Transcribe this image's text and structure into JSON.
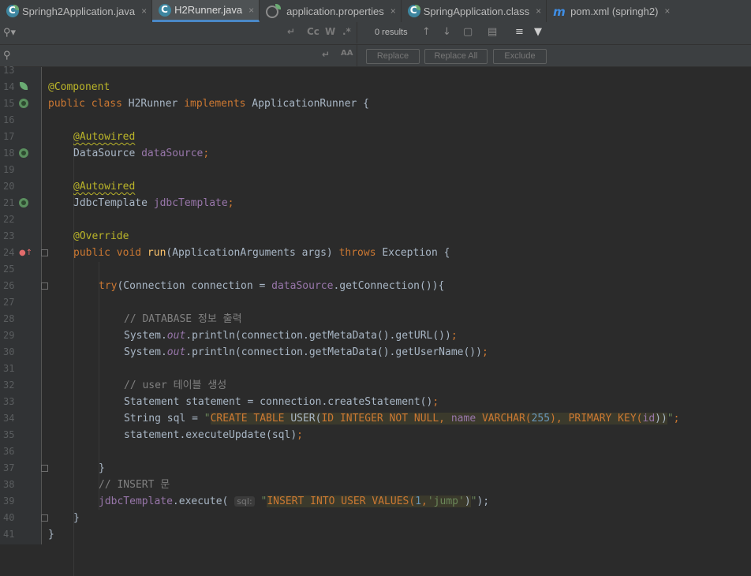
{
  "tabs": [
    {
      "label": "Springh2Application.java",
      "icon": "java-class-spring-icon",
      "active": false
    },
    {
      "label": "H2Runner.java",
      "icon": "java-class-icon",
      "active": true
    },
    {
      "label": "application.properties",
      "icon": "spring-properties-icon",
      "active": false
    },
    {
      "label": "SpringApplication.class",
      "icon": "java-class-spring-icon",
      "active": false
    },
    {
      "label": "pom.xml (springh2)",
      "icon": "maven-icon",
      "active": false
    }
  ],
  "close_glyph": "×",
  "find": {
    "search_placeholder": "",
    "replace_placeholder": "",
    "results": "0 results",
    "match_case": "Cc",
    "words": "W",
    "regex": ".*",
    "preserve_case": "AA",
    "replace_label": "Replace",
    "replace_all_label": "Replace All",
    "exclude_label": "Exclude"
  },
  "lines": [
    {
      "n": "13"
    },
    {
      "n": "14"
    },
    {
      "n": "15"
    },
    {
      "n": "16"
    },
    {
      "n": "17"
    },
    {
      "n": "18"
    },
    {
      "n": "19"
    },
    {
      "n": "20"
    },
    {
      "n": "21"
    },
    {
      "n": "22"
    },
    {
      "n": "23"
    },
    {
      "n": "24"
    },
    {
      "n": "25"
    },
    {
      "n": "26"
    },
    {
      "n": "27"
    },
    {
      "n": "28"
    },
    {
      "n": "29"
    },
    {
      "n": "30"
    },
    {
      "n": "31"
    },
    {
      "n": "32"
    },
    {
      "n": "33"
    },
    {
      "n": "34"
    },
    {
      "n": "35"
    },
    {
      "n": "36"
    },
    {
      "n": "37"
    },
    {
      "n": "38"
    },
    {
      "n": "39"
    },
    {
      "n": "40"
    },
    {
      "n": "41"
    }
  ],
  "code": {
    "l14": "@Component",
    "l15_kw1": "public class ",
    "l15_name": "H2Runner ",
    "l15_kw2": "implements ",
    "l15_rest": "ApplicationRunner {",
    "l17": "@Autowired",
    "l18_type": "DataSource ",
    "l18_field": "dataSource",
    "l18_semi": ";",
    "l20": "@Autowired",
    "l21_type": "JdbcTemplate ",
    "l21_field": "jdbcTemplate",
    "l21_semi": ";",
    "l23": "@Override",
    "l24_kw": "public void ",
    "l24_fn": "run",
    "l24_mid": "(ApplicationArguments args) ",
    "l24_throws": "throws ",
    "l24_end": "Exception {",
    "l26_try": "try",
    "l26_a": "(Connection connection = ",
    "l26_field": "dataSource",
    "l26_b": ".getConnection()){",
    "l28": "// DATABASE 정보 출력",
    "l29_a": "System.",
    "l29_out": "out",
    "l29_b": ".println(connection.getMetaData().getURL())",
    "l29_semi": ";",
    "l30_a": "System.",
    "l30_out": "out",
    "l30_b": ".println(connection.getMetaData().getUserName())",
    "l30_semi": ";",
    "l32": "// user 테이블 생성",
    "l33_a": "Statement statement = connection.createStatement()",
    "l33_semi": ";",
    "l34_a": "String sql = ",
    "l34_q1": "\"",
    "l34_s1": "CREATE TABLE ",
    "l34_s2": "USER(",
    "l34_s3": "ID INTEGER NOT NULL, ",
    "l34_s4": "name ",
    "l34_s5": "VARCHAR(",
    "l34_s6": "255",
    "l34_s7": "), PRIMARY KEY(",
    "l34_s8": "id",
    "l34_s9": "))",
    "l34_q2": "\"",
    "l34_semi": ";",
    "l35_a": "statement.executeUpdate(sql)",
    "l35_semi": ";",
    "l37": "}",
    "l38": "// INSERT 문",
    "l39_field": "jdbcTemplate",
    "l39_a": ".execute( ",
    "l39_hint": "sql:",
    "l39_q1": " \"",
    "l39_s1": "INSERT INTO USER VALUES(",
    "l39_s2": "1",
    "l39_s3": ",",
    "l39_s4": "'jump'",
    "l39_s5": ")",
    "l39_q2": "\"",
    "l39_end": ");",
    "l40": "}",
    "l41": "}"
  }
}
